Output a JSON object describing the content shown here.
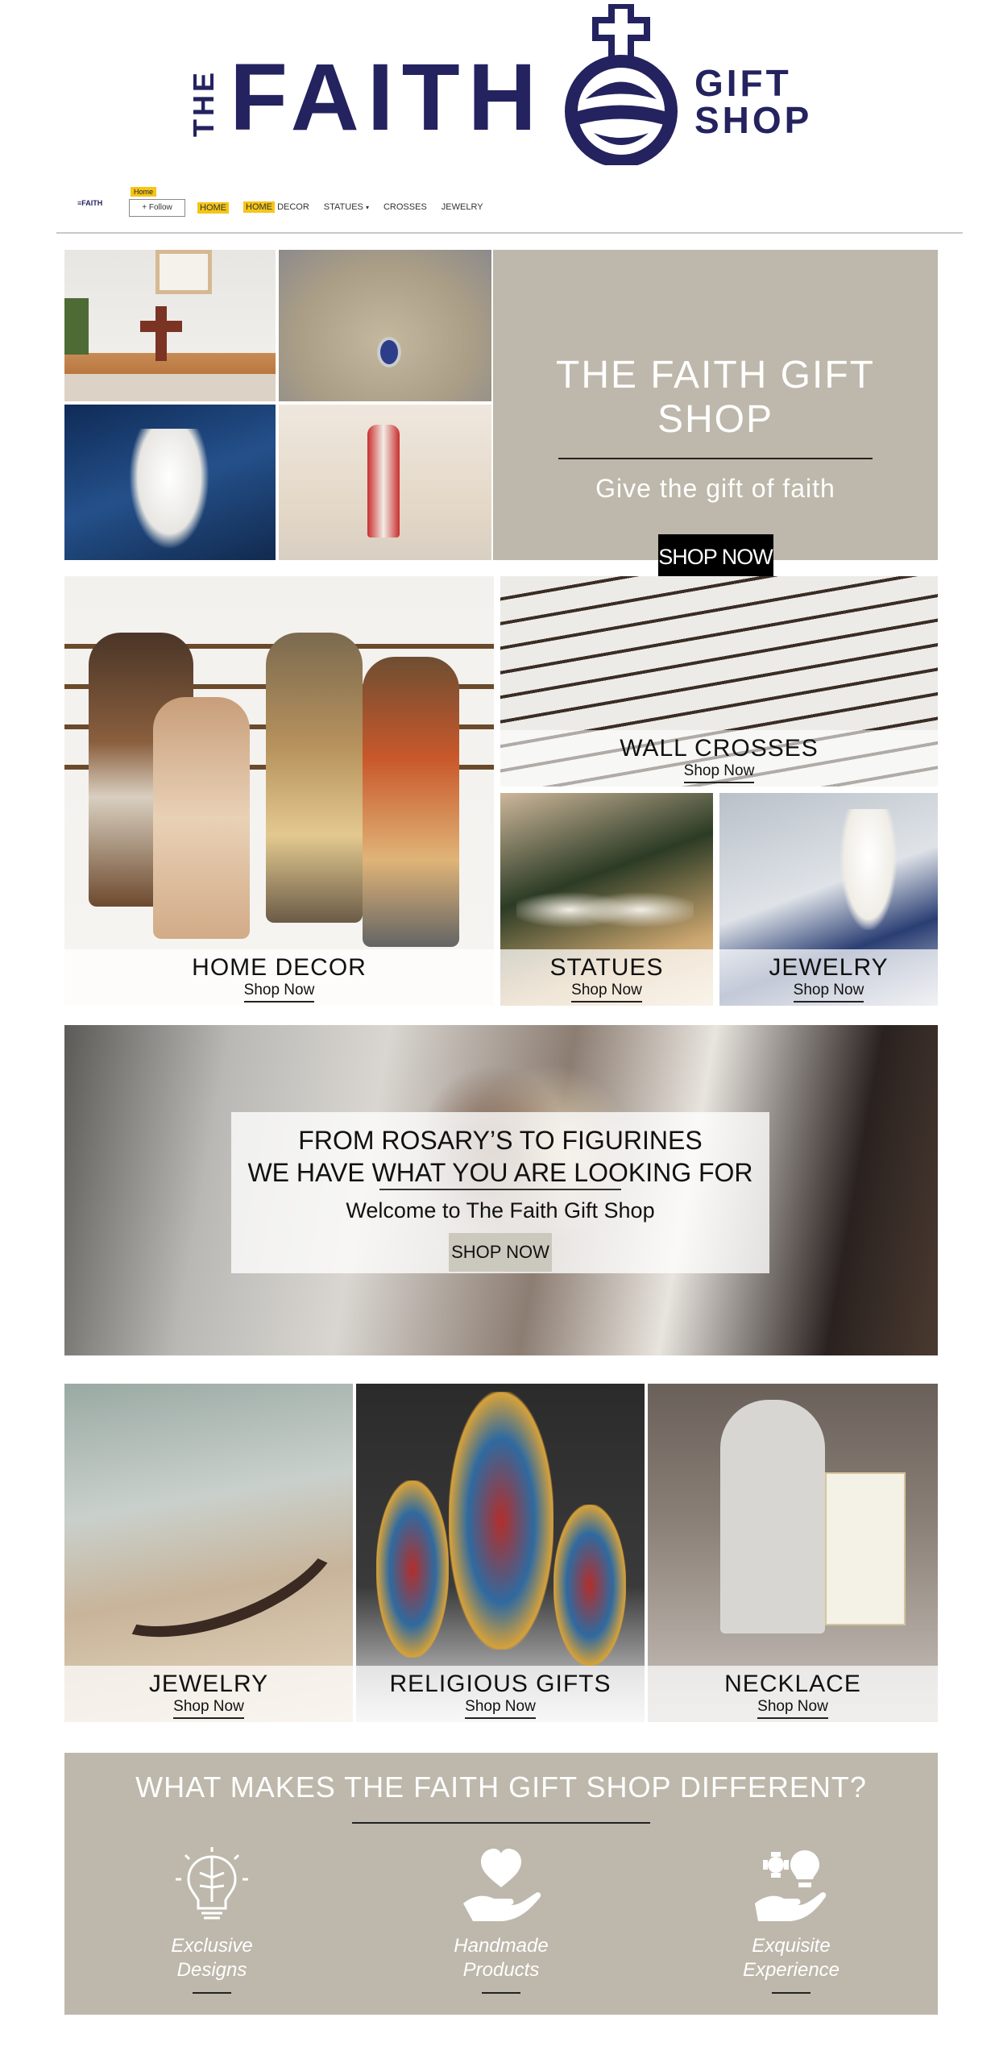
{
  "brand": {
    "the": "THE",
    "faith": "FAITH",
    "gift": "GIFT",
    "shop": "SHOP",
    "color": "#24235f"
  },
  "nav": {
    "mini_logo": "≡FAITH",
    "home_tag": "Home",
    "follow": "+ Follow",
    "links": [
      "HOME",
      "HOME",
      "DECOR",
      "STATUES",
      "CROSSES",
      "JEWELRY"
    ],
    "highlight_color": "#f5c518"
  },
  "hero": {
    "title": "THE FAITH GIFT SHOP",
    "subtitle": "Give the gift of faith",
    "button": "SHOP NOW",
    "panel_color": "#bdb8ab"
  },
  "categories": [
    {
      "title": "HOME DECOR",
      "link": "Shop Now"
    },
    {
      "title": "WALL CROSSES",
      "link": "Shop Now"
    },
    {
      "title": "STATUES",
      "link": "Shop Now"
    },
    {
      "title": "JEWELRY",
      "link": "Shop Now"
    }
  ],
  "banner": {
    "line1": "FROM ROSARY’S TO FIGURINES",
    "line2": "WE HAVE WHAT YOU ARE LOOKING FOR",
    "line3": "Welcome to The Faith Gift Shop",
    "button": "SHOP NOW"
  },
  "gifts": [
    {
      "title": "JEWELRY",
      "link": "Shop Now"
    },
    {
      "title": "RELIGIOUS GIFTS",
      "link": "Shop Now"
    },
    {
      "title": "NECKLACE",
      "link": "Shop Now"
    }
  ],
  "different": {
    "title": "WHAT MAKES THE FAITH GIFT SHOP DIFFERENT?",
    "features": [
      {
        "line1": "Exclusive",
        "line2": "Designs",
        "icon": "lightbulb-brain-icon"
      },
      {
        "line1": "Handmade",
        "line2": "Products",
        "icon": "hand-heart-icon"
      },
      {
        "line1": "Exquisite",
        "line2": "Experience",
        "icon": "hand-gear-bulb-icon"
      }
    ]
  }
}
